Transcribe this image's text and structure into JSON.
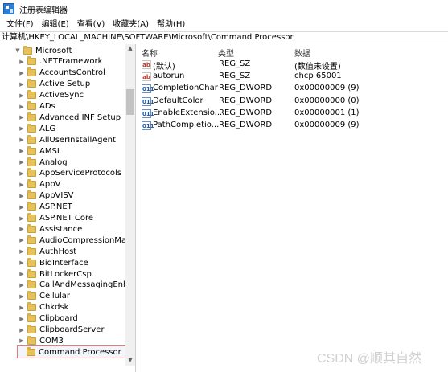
{
  "window": {
    "title": "注册表编辑器"
  },
  "menu": [
    "文件(F)",
    "编辑(E)",
    "查看(V)",
    "收藏夹(A)",
    "帮助(H)"
  ],
  "address": "计算机\\HKEY_LOCAL_MACHINE\\SOFTWARE\\Microsoft\\Command Processor",
  "tree": {
    "root": "Microsoft",
    "items": [
      ".NETFramework",
      "AccountsControl",
      "Active Setup",
      "ActiveSync",
      "ADs",
      "Advanced INF Setup",
      "ALG",
      "AllUserInstallAgent",
      "AMSI",
      "Analog",
      "AppServiceProtocols",
      "AppV",
      "AppVISV",
      "ASP.NET",
      "ASP.NET Core",
      "Assistance",
      "AudioCompressionMan",
      "AuthHost",
      "BidInterface",
      "BitLockerCsp",
      "CallAndMessagingEnha",
      "Cellular",
      "Chkdsk",
      "Clipboard",
      "ClipboardServer",
      "COM3",
      "Command Processor"
    ],
    "selected": "Command Processor"
  },
  "values": {
    "headers": {
      "name": "名称",
      "type": "类型",
      "data": "数据"
    },
    "rows": [
      {
        "icon": "string-value-icon",
        "icon_text": "ab",
        "name": "(默认)",
        "type": "REG_SZ",
        "data": "(数值未设置)"
      },
      {
        "icon": "string-value-icon",
        "icon_text": "ab",
        "name": "autorun",
        "type": "REG_SZ",
        "data": "chcp 65001"
      },
      {
        "icon": "dword-value-icon",
        "icon_text": "011",
        "name": "CompletionChar",
        "type": "REG_DWORD",
        "data": "0x00000009 (9)"
      },
      {
        "icon": "dword-value-icon",
        "icon_text": "011",
        "name": "DefaultColor",
        "type": "REG_DWORD",
        "data": "0x00000000 (0)"
      },
      {
        "icon": "dword-value-icon",
        "icon_text": "011",
        "name": "EnableExtensio...",
        "type": "REG_DWORD",
        "data": "0x00000001 (1)"
      },
      {
        "icon": "dword-value-icon",
        "icon_text": "011",
        "name": "PathCompletio...",
        "type": "REG_DWORD",
        "data": "0x00000009 (9)"
      }
    ]
  },
  "watermark": "CSDN @顺其自然"
}
